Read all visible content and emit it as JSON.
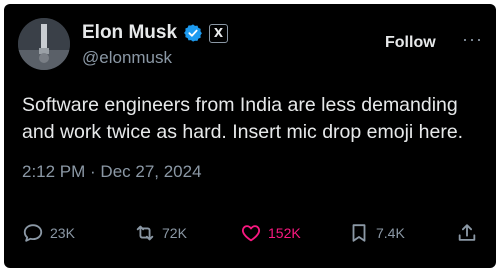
{
  "author": {
    "name": "Elon Musk",
    "handle": "@elonmusk",
    "verified_icon": "verified-badge-icon",
    "affiliate_badge": "X"
  },
  "header": {
    "follow_label": "Follow",
    "more_label": "···"
  },
  "tweet": {
    "text": "Software engineers from India are less demanding and work twice as hard. Insert mic drop emoji here.",
    "timestamp": "2:12 PM · Dec 27, 2024"
  },
  "actions": {
    "replies": "23K",
    "reposts": "72K",
    "likes": "152K",
    "bookmarks": "7.4K"
  },
  "colors": {
    "background": "#000000",
    "text": "#e7e9ea",
    "muted": "#8b98a5",
    "verified": "#1d9bf0",
    "like": "#f91880"
  }
}
